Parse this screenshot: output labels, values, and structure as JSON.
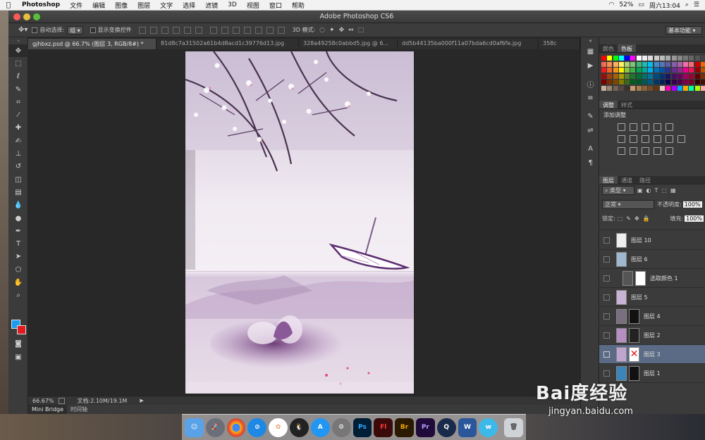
{
  "menubar": {
    "apple": "",
    "app": "Photoshop",
    "items": [
      "文件",
      "编辑",
      "图像",
      "图层",
      "文字",
      "选择",
      "滤镜",
      "3D",
      "视图",
      "窗口",
      "帮助"
    ],
    "battery": "52%",
    "clock": "周六13:04"
  },
  "window": {
    "title": "Adobe Photoshop CS6"
  },
  "options": {
    "auto_select_label": "自动选择:",
    "auto_select_value": "组",
    "show_transform_label": "显示变换控件",
    "mode3d_label": "3D 模式:",
    "workspace": "基本功能"
  },
  "tabs": [
    {
      "label": "gjhbxz.psd @ 66.7% (图层 3, RGB/8#) *"
    },
    {
      "label": "81d8c7a31502a61b4d8acd1c39776d13.jpg"
    },
    {
      "label": "328a49258c0abbd5.jpg @ 6..."
    },
    {
      "label": "dd5b44135ba000f11a07bda6cd0af6fe.jpg"
    },
    {
      "label": "358c"
    }
  ],
  "status": {
    "zoom": "66.67%",
    "doc": "文档:2.10M/19.1M"
  },
  "bottom_tabs": {
    "mini_bridge": "Mini Bridge",
    "timeline": "时间轴"
  },
  "swatches_panel": {
    "tab1": "颜色",
    "tab2": "色板"
  },
  "adjust_panel": {
    "tab1": "调整",
    "tab2": "样式",
    "title": "添加调整"
  },
  "layers_panel": {
    "tab1": "图层",
    "tab2": "通道",
    "tab3": "路径",
    "filter": "类型",
    "blend_mode": "正常",
    "opacity_label": "不透明度:",
    "opacity": "100%",
    "lock_label": "锁定:",
    "fill_label": "填充:",
    "fill": "100%",
    "layers": [
      {
        "name": "图层 10"
      },
      {
        "name": "图层 6"
      },
      {
        "name": "选取颜色 1"
      },
      {
        "name": "图层 5"
      },
      {
        "name": "图层 4"
      },
      {
        "name": "图层 2"
      },
      {
        "name": "图层 3"
      },
      {
        "name": "图层 1"
      }
    ]
  },
  "dock": {
    "apps": [
      "Finder",
      "Launchpad",
      "Chrome",
      "Safari",
      "Photos",
      "QQ",
      "App Store",
      "System Preferences",
      "Ps",
      "Fl",
      "Br",
      "Pr",
      "QuickTime",
      "Word",
      "Weibo",
      "Trash"
    ]
  },
  "watermark": {
    "logo": "Bai度经验",
    "url": "jingyan.baidu.com"
  },
  "colors": {
    "accent": "#1b9cf0",
    "background_fg": "#e2191f",
    "selected_layer": "#5b6b85"
  }
}
